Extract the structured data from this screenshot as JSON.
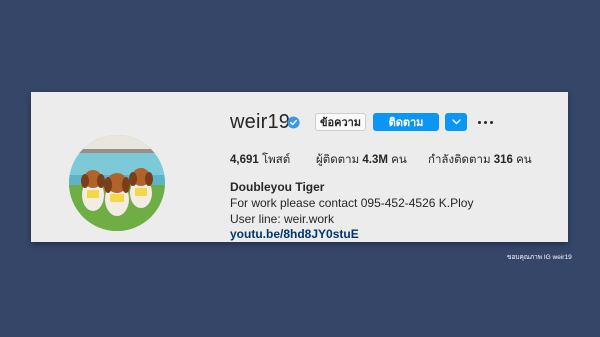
{
  "profile": {
    "username": "weir19",
    "verified_icon": "verified-badge-icon",
    "message_label": "ข้อความ",
    "follow_label": "ติดตาม",
    "dropdown_icon": "chevron-down-icon",
    "more_icon": "more-options-icon",
    "stats": {
      "posts_value": "4,691",
      "posts_label": " โพสต์",
      "followers_label": "ผู้ติดตาม ",
      "followers_value": "4.3M",
      "followers_unit": " คน",
      "following_label": "กำลังติดตาม ",
      "following_value": "316",
      "following_unit": " คน"
    },
    "full_name": "Doubleyou Tiger",
    "bio_line1": "For work please contact 095-452-4526 K.Ploy",
    "bio_line2": "User line: weir.work",
    "link": "youtu.be/8hd8JY0stuE",
    "avatar": "profile-photo-three-beagles"
  },
  "colors": {
    "background": "#354669",
    "card": "#ececec",
    "accent_blue": "#0d95f6",
    "link": "#00376b"
  },
  "credit": "ขอบคุณภาพ IG weir19"
}
